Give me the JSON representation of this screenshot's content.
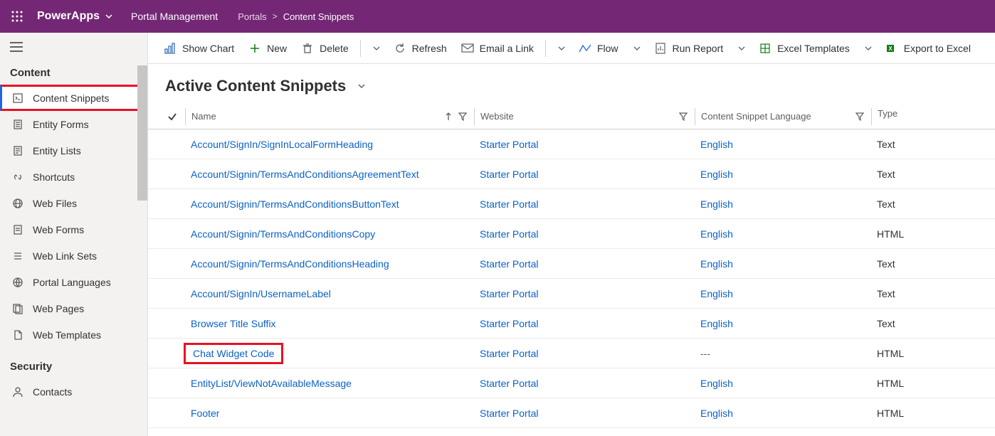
{
  "topbar": {
    "app_name": "PowerApps",
    "area": "Portal Management",
    "breadcrumb_parent": "Portals",
    "breadcrumb_current": "Content Snippets"
  },
  "sidebar": {
    "group1_label": "Content",
    "items1": [
      {
        "label": "Content Snippets",
        "active": true,
        "highlight": true,
        "icon": "content-snippets-icon"
      },
      {
        "label": "Entity Forms",
        "icon": "entity-forms-icon"
      },
      {
        "label": "Entity Lists",
        "icon": "entity-lists-icon"
      },
      {
        "label": "Shortcuts",
        "icon": "shortcuts-icon"
      },
      {
        "label": "Web Files",
        "icon": "web-files-icon"
      },
      {
        "label": "Web Forms",
        "icon": "web-forms-icon"
      },
      {
        "label": "Web Link Sets",
        "icon": "web-link-sets-icon"
      },
      {
        "label": "Portal Languages",
        "icon": "portal-languages-icon"
      },
      {
        "label": "Web Pages",
        "icon": "web-pages-icon"
      },
      {
        "label": "Web Templates",
        "icon": "web-templates-icon"
      }
    ],
    "group2_label": "Security",
    "items2": [
      {
        "label": "Contacts",
        "icon": "contacts-icon"
      }
    ]
  },
  "commands": {
    "show_chart": "Show Chart",
    "new": "New",
    "delete": "Delete",
    "refresh": "Refresh",
    "email_link": "Email a Link",
    "flow": "Flow",
    "run_report": "Run Report",
    "excel_templates": "Excel Templates",
    "export_excel": "Export to Excel"
  },
  "view": {
    "title": "Active Content Snippets",
    "columns": {
      "name": "Name",
      "website": "Website",
      "language": "Content Snippet Language",
      "type": "Type"
    }
  },
  "rows": [
    {
      "name": "Account/SignIn/SignInLocalFormHeading",
      "website": "Starter Portal",
      "language": "English",
      "type": "Text"
    },
    {
      "name": "Account/Signin/TermsAndConditionsAgreementText",
      "website": "Starter Portal",
      "language": "English",
      "type": "Text"
    },
    {
      "name": "Account/Signin/TermsAndConditionsButtonText",
      "website": "Starter Portal",
      "language": "English",
      "type": "Text"
    },
    {
      "name": "Account/Signin/TermsAndConditionsCopy",
      "website": "Starter Portal",
      "language": "English",
      "type": "HTML"
    },
    {
      "name": "Account/Signin/TermsAndConditionsHeading",
      "website": "Starter Portal",
      "language": "English",
      "type": "Text"
    },
    {
      "name": "Account/SignIn/UsernameLabel",
      "website": "Starter Portal",
      "language": "English",
      "type": "Text"
    },
    {
      "name": "Browser Title Suffix",
      "website": "Starter Portal",
      "language": "English",
      "type": "Text"
    },
    {
      "name": "Chat Widget Code",
      "website": "Starter Portal",
      "language": "---",
      "type": "HTML",
      "highlight": true,
      "lang_muted": true
    },
    {
      "name": "EntityList/ViewNotAvailableMessage",
      "website": "Starter Portal",
      "language": "English",
      "type": "HTML"
    },
    {
      "name": "Footer",
      "website": "Starter Portal",
      "language": "English",
      "type": "HTML"
    }
  ]
}
